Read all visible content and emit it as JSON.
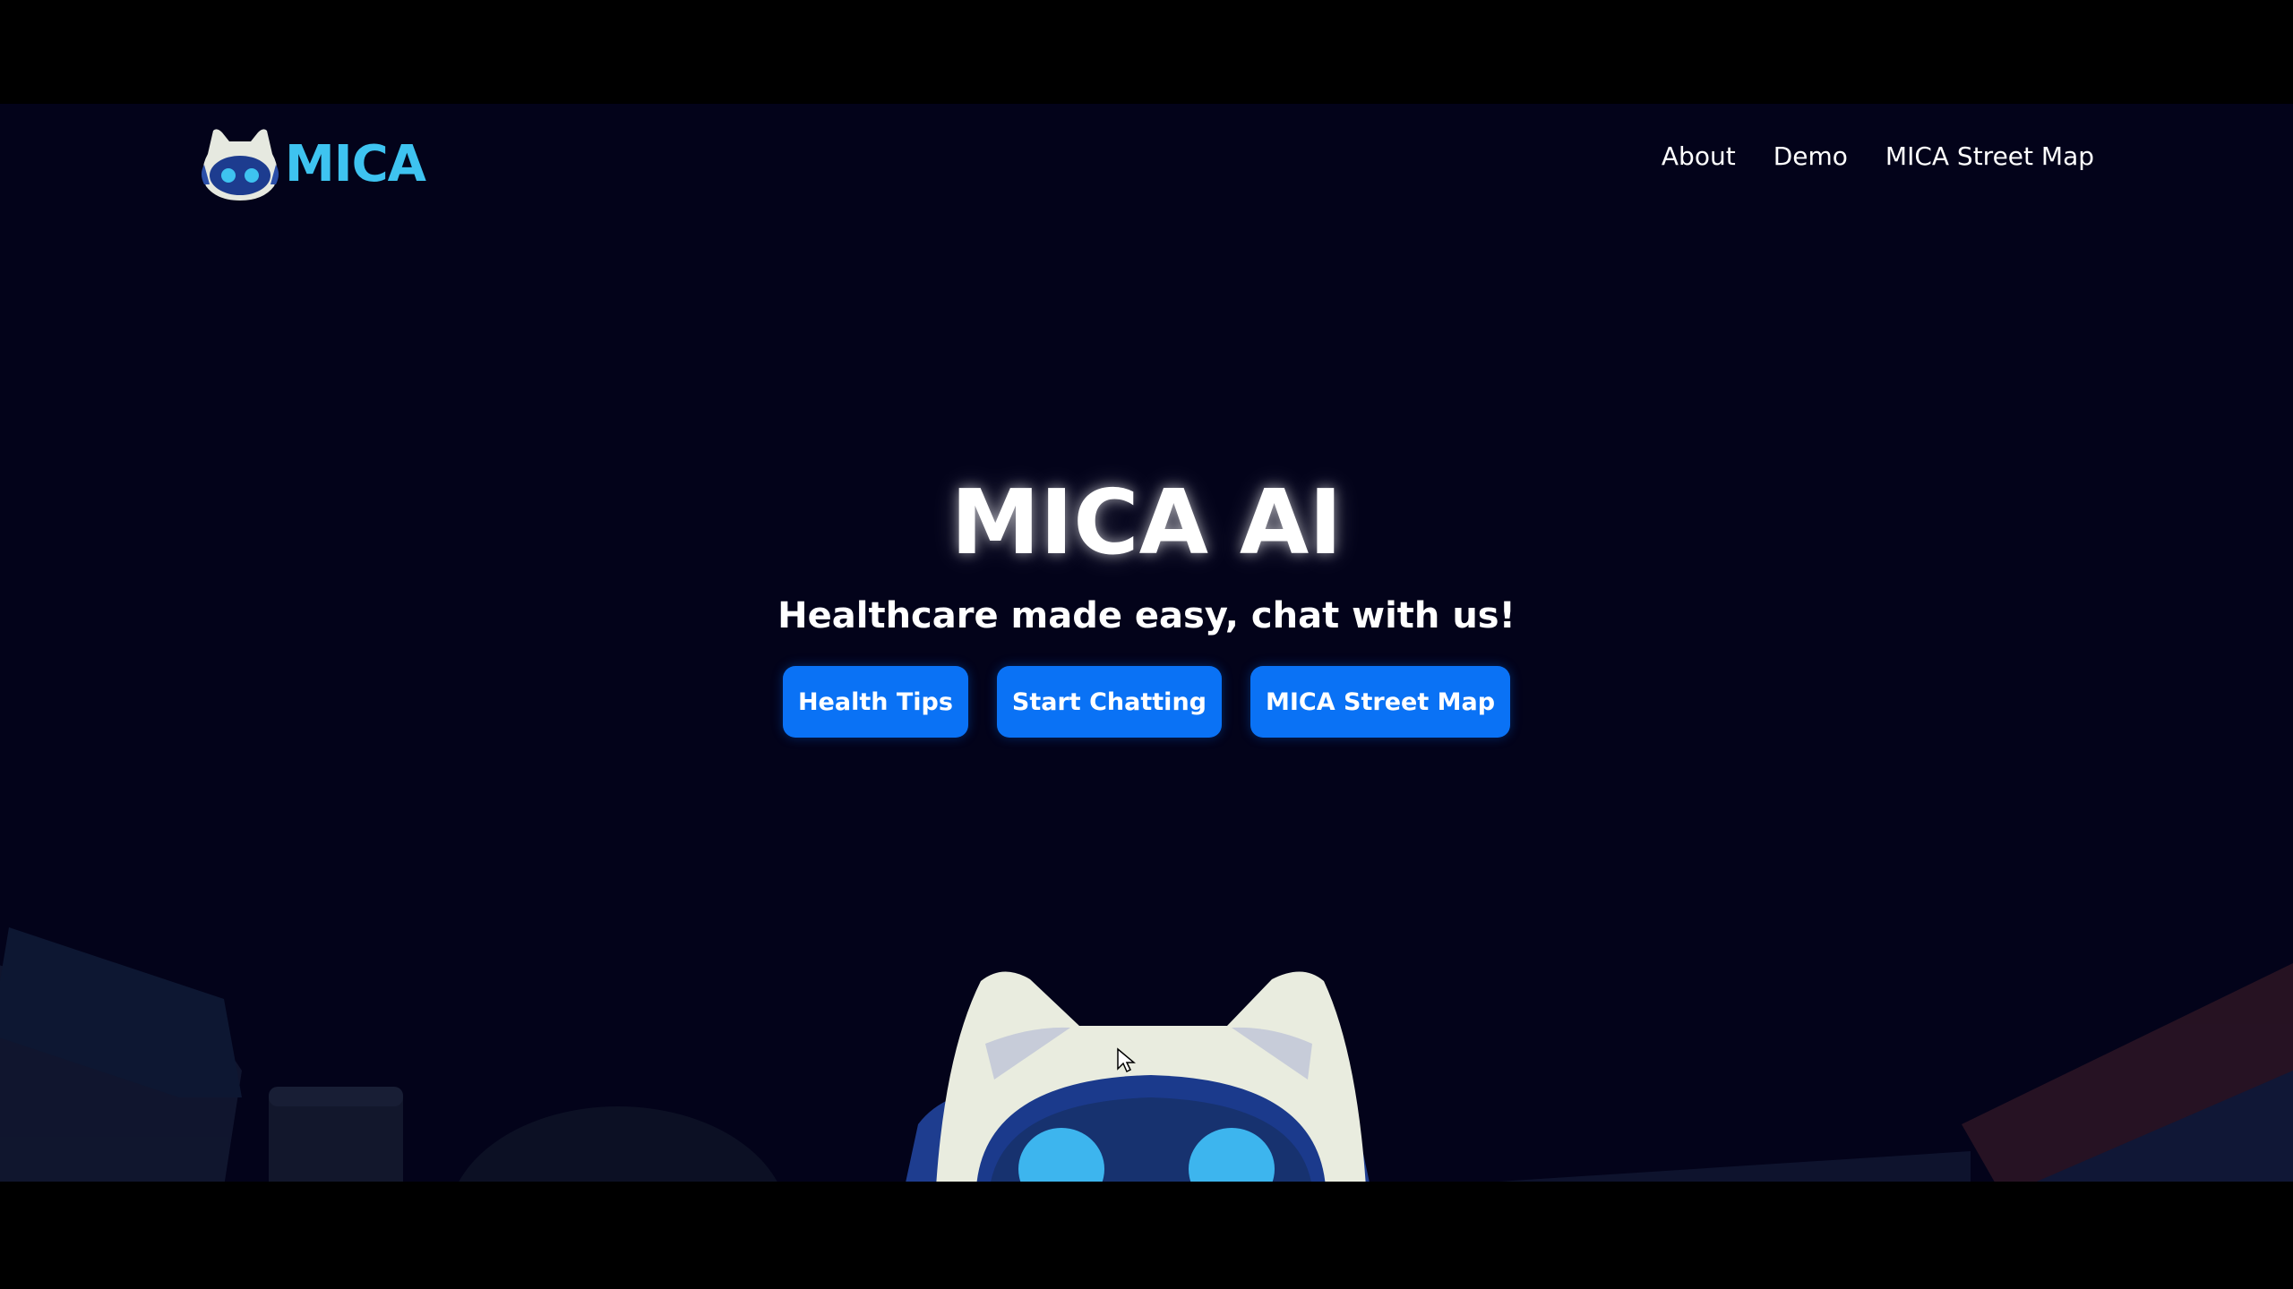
{
  "brand": {
    "name": "MICA",
    "logo_icon": "robot-cat-icon",
    "accent_color": "#3ec3f0"
  },
  "nav": {
    "items": [
      {
        "label": "About"
      },
      {
        "label": "Demo"
      },
      {
        "label": "MICA Street Map"
      }
    ]
  },
  "hero": {
    "title": "MICA AI",
    "subtitle": "Healthcare made easy, chat with us!",
    "buttons": [
      {
        "label": "Health Tips"
      },
      {
        "label": "Start Chatting"
      },
      {
        "label": "MICA Street Map"
      }
    ],
    "button_color": "#0a72f5"
  },
  "mascot": {
    "icon": "robot-cat-mascot-icon"
  },
  "colors": {
    "background": "#03031a",
    "text": "#ffffff"
  }
}
